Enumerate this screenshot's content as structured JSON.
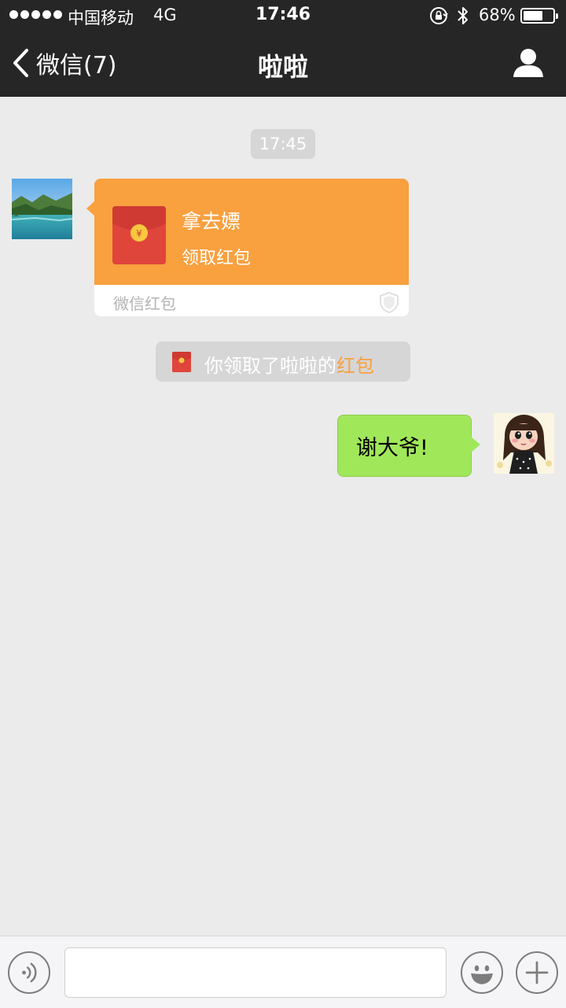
{
  "status_bar": {
    "carrier": "中国移动",
    "network": "4G",
    "time": "17:46",
    "battery_percent": "68%",
    "battery_level": 0.68,
    "signal_dots": 5
  },
  "nav": {
    "back_label": "微信(7)",
    "title": "啦啦"
  },
  "chat": {
    "timestamp": "17:45",
    "red_packet": {
      "greeting": "拿去嫖",
      "action": "领取红包",
      "brand": "微信红包"
    },
    "notice": {
      "text": "你领取了啦啦的",
      "link": "红包"
    },
    "sent_message": "谢大爷!"
  },
  "input_bar": {
    "placeholder": ""
  },
  "colors": {
    "bar_background": "#262626",
    "chat_background": "#ebebeb",
    "red_packet_orange": "#f9a03f",
    "sent_bubble_green": "#a0e75a",
    "notice_gray": "#d6d6d6"
  },
  "icons": {
    "back": "chevron-left-icon",
    "profile": "person-icon",
    "lock": "rotation-lock-icon",
    "bluetooth": "bluetooth-icon",
    "red_packet": "red-envelope-icon",
    "shield": "shield-icon",
    "voice": "voice-icon",
    "emoji": "emoji-icon",
    "plus": "plus-icon"
  }
}
